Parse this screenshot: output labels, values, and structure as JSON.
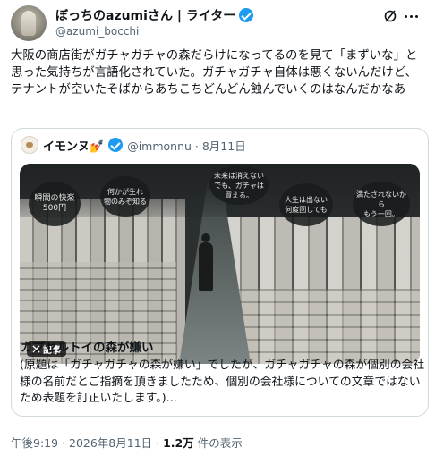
{
  "author": {
    "display_name": "ぼっちのazumiさん | ライター",
    "handle": "@azumi_bocchi"
  },
  "tweet": {
    "text": "大阪の商店街がガチャガチャの森だらけになってるのを見て「まずいな」と思った気持ちが言語化されていた。ガチャガチャ自体は悪くないんだけど、テナントが空いたそばからあちこちどんどん蝕んでいくのはなんだかなあ"
  },
  "quote": {
    "display_name": "イモンヌ💅",
    "handle_date": "@immonnu · 8月11日",
    "image_signs": [
      "瞬間の快楽\n500円",
      "何かが生れ\n物のみぞ知る",
      "未来は消えない\nでも、ガチャは\n買える。",
      "人生は出ない\n何度回しても",
      "満たされないから\nもう一回。"
    ],
    "badge_label": "記事",
    "title": "カプセルトイの森が嫌い",
    "description": "(原題は「ガチャガチャの森が嫌い」でしたが、ガチャガチャの森が個別の会社様の名前だとご指摘を頂きましたため、個別の会社様についての文章ではないため表題を訂正いたします。)..."
  },
  "meta": {
    "time": "午後9:19 · 2026年8月11日 · ",
    "views": "1.2万",
    "views_suffix": " 件の表示"
  },
  "icons": {
    "verified": "verified-badge-icon",
    "grok": "grok-icon",
    "more": "more-icon",
    "x": "x-logo-icon"
  },
  "colors": {
    "verified": "#1d9bf0",
    "secondary_text": "#536471",
    "border": "#cfd9de"
  }
}
